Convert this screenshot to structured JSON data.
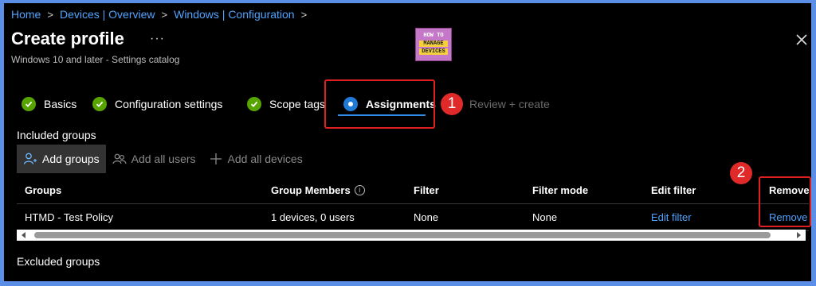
{
  "breadcrumb": [
    "Home",
    "Devices | Overview",
    "Windows | Configuration"
  ],
  "header": {
    "title": "Create profile",
    "more": "···",
    "subtitle": "Windows 10 and later - Settings catalog"
  },
  "logo": {
    "line1": "HOW TO",
    "line2": "MANAGE",
    "line3": "DEVICES"
  },
  "steps": [
    {
      "label": "Basics",
      "status": "complete"
    },
    {
      "label": "Configuration settings",
      "status": "complete"
    },
    {
      "label": "Scope tags",
      "status": "complete"
    },
    {
      "label": "Assignments",
      "status": "current"
    },
    {
      "label": "Review + create",
      "status": "disabled"
    }
  ],
  "callouts": [
    "1",
    "2"
  ],
  "included": {
    "title": "Included groups",
    "toolbar": {
      "add_groups": "Add groups",
      "add_all_users": "Add all users",
      "add_all_devices": "Add all devices"
    },
    "columns": [
      "Groups",
      "Group Members",
      "Filter",
      "Filter mode",
      "Edit filter",
      "Remove"
    ],
    "rows": [
      {
        "group": "HTMD - Test Policy",
        "members": "1 devices, 0 users",
        "filter": "None",
        "filter_mode": "None",
        "edit_filter": "Edit filter",
        "remove": "Remove"
      }
    ]
  },
  "excluded": {
    "title": "Excluded groups"
  },
  "colors": {
    "accent": "#4fa3ff",
    "check": "#57a300",
    "highlight": "#e02020"
  }
}
